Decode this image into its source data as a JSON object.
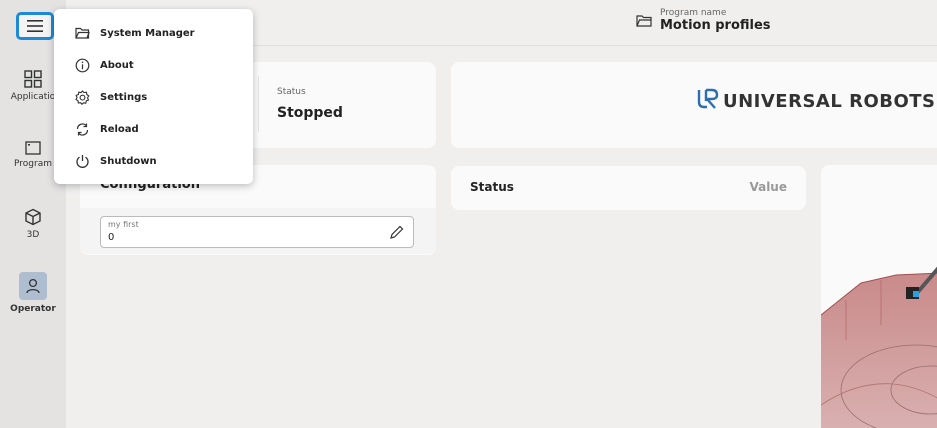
{
  "sidebar": {
    "menu_icon": "hamburger-icon",
    "items": [
      {
        "label": "Applicatio",
        "icon": "grid-icon"
      },
      {
        "label": "Program",
        "icon": "window-icon"
      },
      {
        "label": "3D",
        "icon": "cube-icon"
      },
      {
        "label": "Operator",
        "icon": "person-icon",
        "active": true
      }
    ]
  },
  "header": {
    "program_name_label": "Program name",
    "program_name": "Motion profiles",
    "folder_icon": "folder-icon"
  },
  "status_card": {
    "label": "Status",
    "value": "Stopped"
  },
  "logo": {
    "text": "UNIVERSAL ROBOTS",
    "mark": "UR"
  },
  "configuration": {
    "title": "Configuration",
    "field": {
      "label": "my first",
      "value": "0",
      "edit_icon": "pencil-icon"
    }
  },
  "variables_table": {
    "col_status": "Status",
    "col_value": "Value"
  },
  "menu": {
    "items": [
      {
        "label": "System Manager",
        "icon": "folder-open-icon"
      },
      {
        "label": "About",
        "icon": "info-icon"
      },
      {
        "label": "Settings",
        "icon": "gear-icon"
      },
      {
        "label": "Reload",
        "icon": "reload-icon"
      },
      {
        "label": "Shutdown",
        "icon": "power-icon"
      }
    ]
  },
  "colors": {
    "accent": "#1c8ad6",
    "active_nav": "#aebed0",
    "robot_base": "#c98a8a"
  }
}
